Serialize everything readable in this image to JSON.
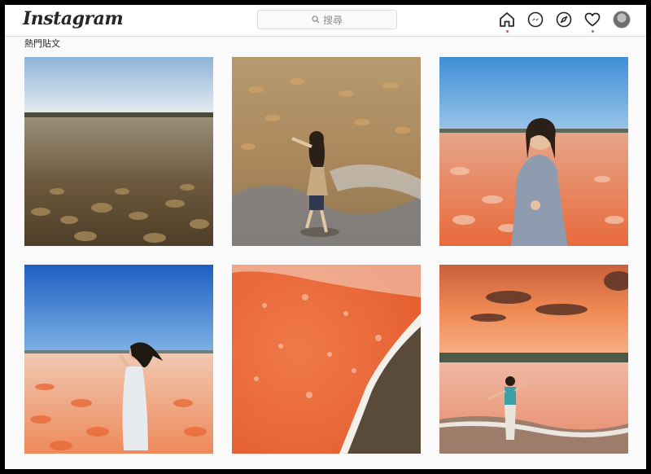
{
  "app": {
    "logo": "Instagram"
  },
  "search": {
    "placeholder": "搜尋"
  },
  "section": {
    "title": "熱門貼文"
  },
  "nav": {
    "icons": [
      "home-icon",
      "messenger-icon",
      "explore-icon",
      "activity-heart-icon",
      "profile-avatar"
    ],
    "notification_color": "#ed4956"
  },
  "posts": [
    {
      "name": "salt-flat-landscape",
      "palette": "brown-water"
    },
    {
      "name": "woman-on-salt-flat-hat",
      "palette": "brown-water"
    },
    {
      "name": "woman-smiling-pink-flat",
      "palette": "pink-blue"
    },
    {
      "name": "woman-hair-blowing-blue-sky",
      "palette": "orange-blue"
    },
    {
      "name": "orange-salt-water-aerial",
      "palette": "orange"
    },
    {
      "name": "woman-sunset-pink-lake",
      "palette": "sunset"
    }
  ]
}
